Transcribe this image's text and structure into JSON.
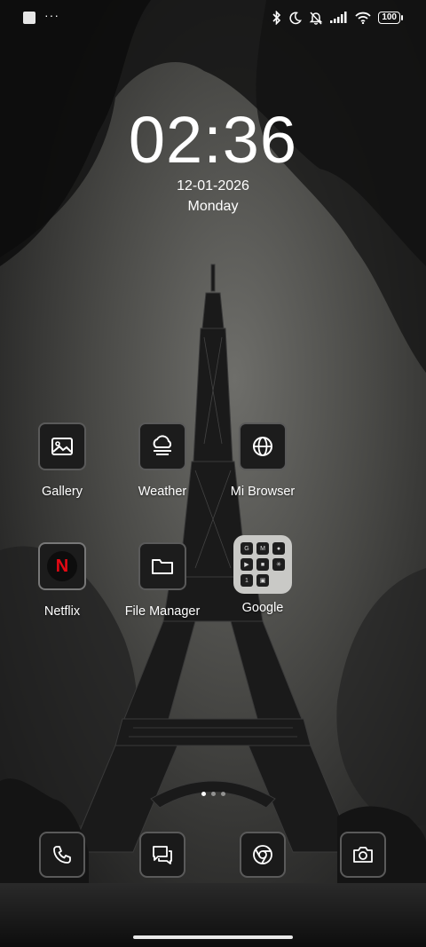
{
  "status_bar": {
    "left_icons": [
      "notification-square-icon",
      "more-dots-icon"
    ],
    "right_icons": [
      "bluetooth-icon",
      "do-not-disturb-moon-icon",
      "muted-bell-icon",
      "cell-signal-icon",
      "wifi-icon"
    ],
    "battery_level": "100"
  },
  "clock": {
    "time": "02:36",
    "date": "12-01-2026",
    "day": "Monday"
  },
  "apps": [
    {
      "label": "Gallery",
      "icon": "image-icon"
    },
    {
      "label": "Weather",
      "icon": "cloud-icon"
    },
    {
      "label": "Mi Browser",
      "icon": "globe-icon"
    },
    {
      "label": "Netflix",
      "icon": "netflix-icon",
      "accent": "#e50914"
    },
    {
      "label": "File Manager",
      "icon": "folder-icon"
    },
    {
      "label": "Google",
      "icon": "google-folder-icon"
    }
  ],
  "google_folder": {
    "mini_apps": [
      "google-icon",
      "gmail-icon",
      "contacts-icon",
      "youtube-icon",
      "meet-icon",
      "photos-icon",
      "one-icon",
      "duo-icon",
      "calendar-icon"
    ],
    "mini_letters": [
      "G",
      "M",
      "",
      "",
      "",
      "",
      "1",
      "",
      ""
    ]
  },
  "page_indicator": {
    "pages": 3,
    "current": 1
  },
  "dock": [
    "phone-icon",
    "messages-icon",
    "chrome-icon",
    "camera-icon"
  ]
}
